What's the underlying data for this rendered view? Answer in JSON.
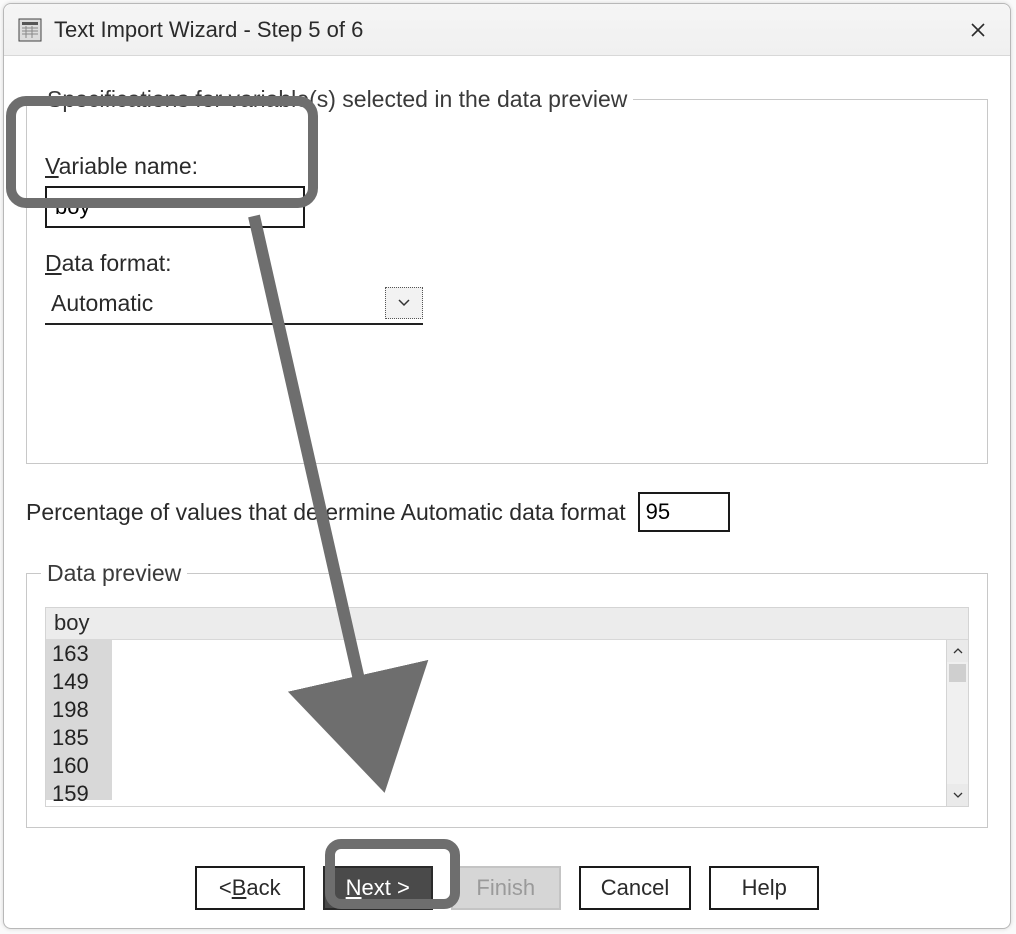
{
  "title": "Text Import Wizard - Step 5 of 6",
  "spec_group": {
    "legend": "Specifications for variable(s) selected in the data preview",
    "variable_name_label_pre": "V",
    "variable_name_label_post": "ariable name:",
    "variable_name_value": "boy",
    "data_format_label_pre": "D",
    "data_format_label_post": "ata format:",
    "data_format_value": "Automatic"
  },
  "percentage": {
    "label_pre": "P",
    "label_post": "ercentage of values that determine Automatic data format",
    "value": "95"
  },
  "preview": {
    "legend": "Data preview",
    "header": "boy",
    "rows": [
      "163",
      "149",
      "198",
      "185",
      "160",
      "159"
    ]
  },
  "buttons": {
    "back_pre": "< ",
    "back_access": "B",
    "back_post": "ack",
    "next_access": "N",
    "next_post": "ext  >",
    "finish": "Finish",
    "cancel": "Cancel",
    "help": "Help"
  }
}
